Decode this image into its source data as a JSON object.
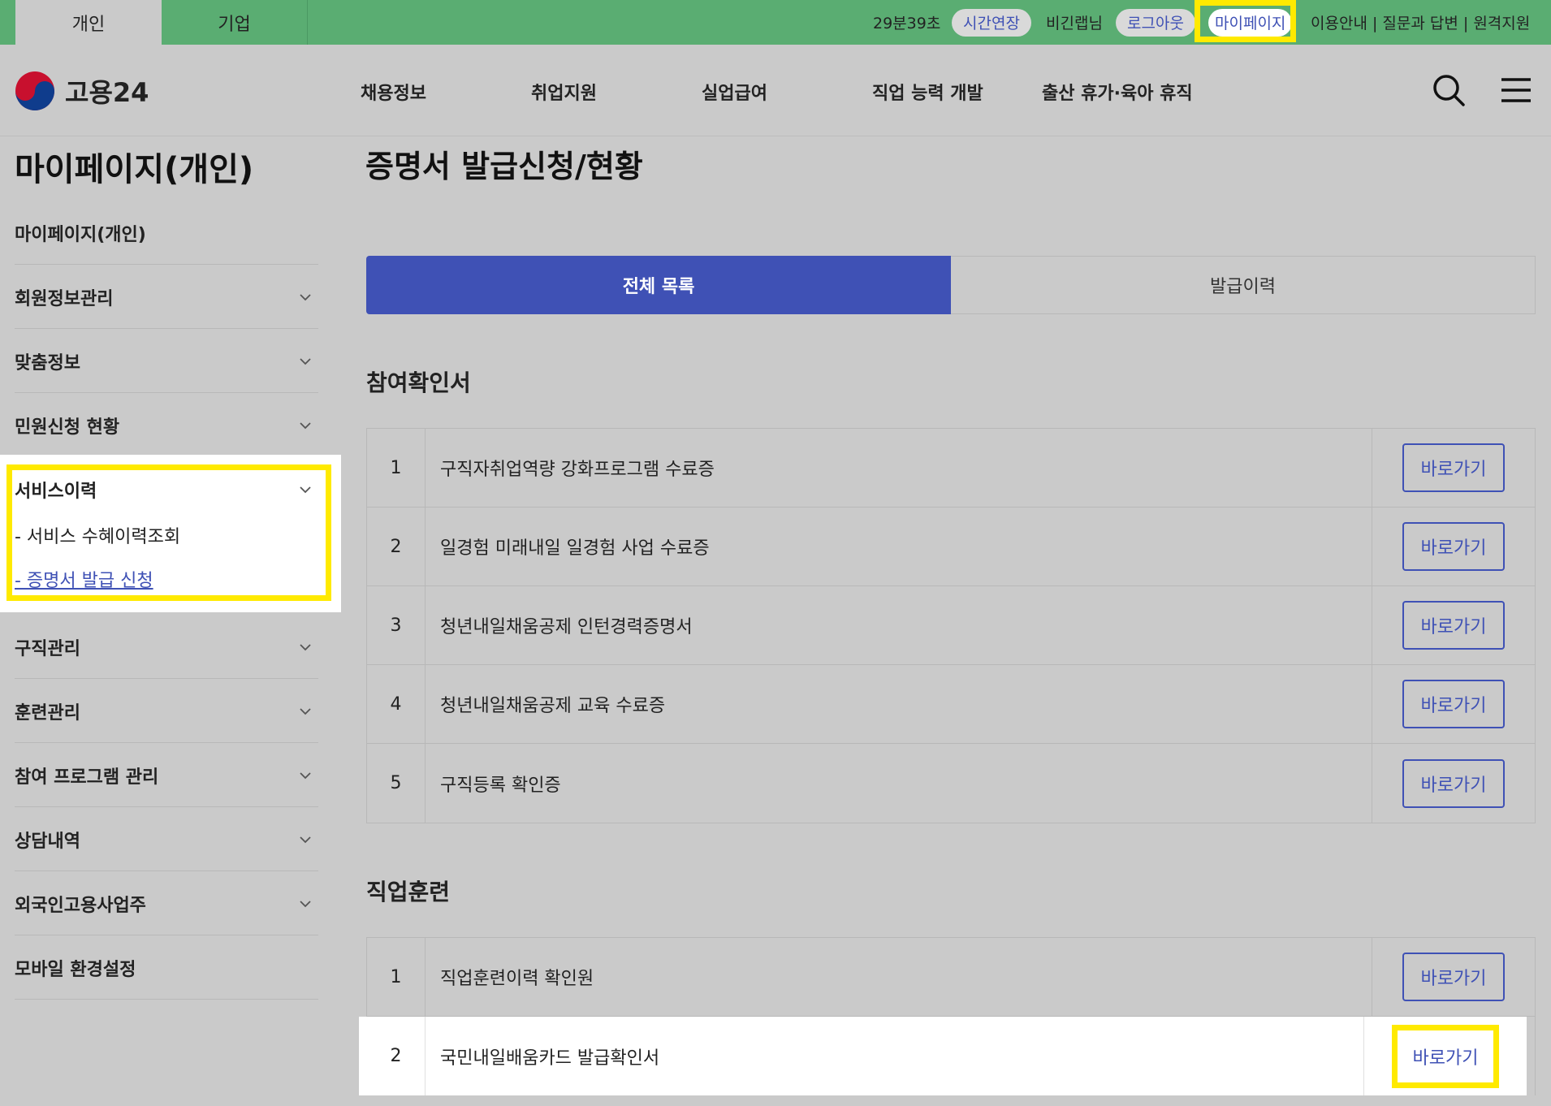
{
  "topbar": {
    "tab_personal": "개인",
    "tab_company": "기업",
    "timer": "29분39초",
    "extend_label": "시간연장",
    "user_name": "비긴랩님",
    "logout_label": "로그아웃",
    "mypage_label": "마이페이지",
    "util_links": "이용안내 | 질문과 답변 | 원격지원"
  },
  "header": {
    "logo_text": "고용24",
    "nav": [
      "채용정보",
      "취업지원",
      "실업급여",
      "직업 능력 개발",
      "출산 휴가·육아 휴직"
    ],
    "icons": [
      "search-icon",
      "menu-icon"
    ]
  },
  "sidebar": {
    "title": "마이페이지(개인)",
    "items": [
      {
        "label": "마이페이지(개인)"
      },
      {
        "label": "회원정보관리"
      },
      {
        "label": "맞춤정보"
      },
      {
        "label": "민원신청 현황"
      },
      {
        "label": "서비스이력"
      },
      {
        "label": "구직관리"
      },
      {
        "label": "훈련관리"
      },
      {
        "label": "참여 프로그램 관리"
      },
      {
        "label": "상담내역"
      },
      {
        "label": "외국인고용사업주"
      },
      {
        "label": "모바일 환경설정"
      }
    ],
    "sub_items": [
      "- 서비스 수혜이력조회",
      "- 증명서 발급 신청"
    ]
  },
  "main": {
    "title": "증명서 발급신청/현황",
    "tabs": [
      "전체 목록",
      "발급이력"
    ],
    "sections": [
      {
        "title": "참여확인서",
        "rows": [
          {
            "no": "1",
            "name": "구직자취업역량 강화프로그램 수료증",
            "action": "바로가기"
          },
          {
            "no": "2",
            "name": "일경험 미래내일 일경험 사업 수료증",
            "action": "바로가기"
          },
          {
            "no": "3",
            "name": "청년내일채움공제 인턴경력증명서",
            "action": "바로가기"
          },
          {
            "no": "4",
            "name": "청년내일채움공제 교육 수료증",
            "action": "바로가기"
          },
          {
            "no": "5",
            "name": "구직등록 확인증",
            "action": "바로가기"
          }
        ]
      },
      {
        "title": "직업훈련",
        "rows": [
          {
            "no": "1",
            "name": "직업훈련이력 확인원",
            "action": "바로가기"
          },
          {
            "no": "2",
            "name": "국민내일배움카드 발급확인서",
            "action": "바로가기"
          }
        ]
      }
    ]
  },
  "colors": {
    "brand_green": "#5aad72",
    "accent_blue": "#3f51b5",
    "highlight": "#ffea00"
  }
}
